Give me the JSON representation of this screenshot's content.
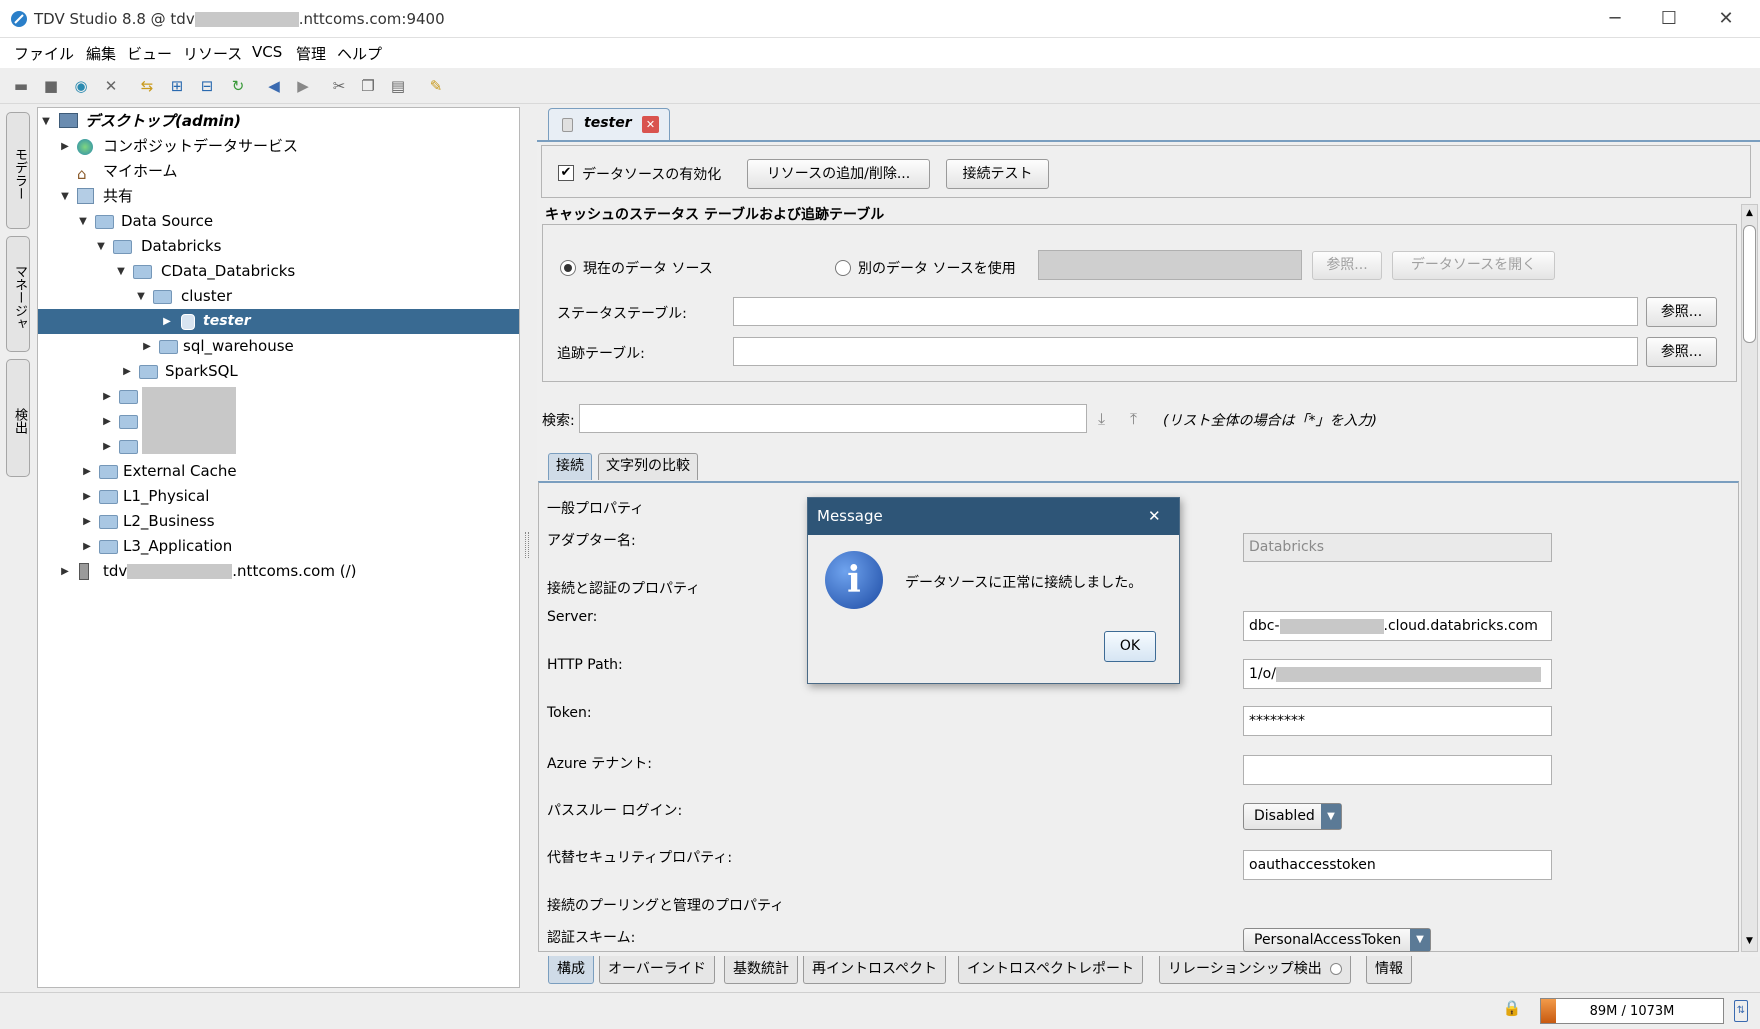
{
  "window": {
    "title": "TDV Studio 8.8 @ tdv",
    "title_suffix": ".nttcoms.com:9400",
    "minimize": "─",
    "maximize": "☐",
    "close": "✕"
  },
  "menu": [
    "ファイル",
    "編集",
    "ビュー",
    "リソース",
    "VCS",
    "管理",
    "ヘルプ"
  ],
  "side_tabs": [
    "モデラー",
    "マネージャ",
    "検出"
  ],
  "tree": {
    "root": "デスクトップ(admin)",
    "composite": "コンポジットデータサービス",
    "home": "マイホーム",
    "shared": "共有",
    "data_source": "Data Source",
    "databricks": "Databricks",
    "cdata": "CData_Databricks",
    "cluster": "cluster",
    "tester": "tester",
    "sql_warehouse": "sql_warehouse",
    "sparksql": "SparkSQL",
    "external_cache": "External Cache",
    "l1": "L1_Physical",
    "l2": "L2_Business",
    "l3": "L3_Application",
    "server_prefix": "tdv",
    "server_suffix": ".nttcoms.com (/)"
  },
  "editor_tab": "tester",
  "top_panel": {
    "enable_label": "データソースの有効化",
    "enable_checked": true,
    "add_remove": "リソースの追加/削除...",
    "test": "接続テスト"
  },
  "cache": {
    "heading": "キャッシュのステータス テーブルおよび追跡テーブル",
    "current": "現在のデータ ソース",
    "other": "別のデータ ソースを使用",
    "browse": "参照...",
    "open": "データソースを開く",
    "status_label": "ステータステーブル:",
    "status_value": "",
    "tracking_label": "追跡テーブル:",
    "tracking_value": ""
  },
  "search": {
    "label": "検索:",
    "value": "",
    "hint": "(リスト全体の場合は「*」を入力)"
  },
  "subtabs": [
    "接続",
    "文字列の比較"
  ],
  "props": {
    "general": "一般プロパティ",
    "adapter_label": "アダプター名:",
    "adapter_value": "Databricks",
    "conn_auth": "接続と認証のプロパティ",
    "server_label": "Server:",
    "server_prefix": "dbc-",
    "server_suffix": ".cloud.databricks.com",
    "http_label": "HTTP Path:",
    "http_prefix": "1/o/",
    "token_label": "Token:",
    "token_value": "********",
    "azure_label": "Azure テナント:",
    "azure_value": "",
    "passthru_label": "パススルー ログイン:",
    "passthru_value": "Disabled",
    "alt_sec_label": "代替セキュリティプロパティ:",
    "alt_sec_value": "oauthaccesstoken",
    "pooling": "接続のプーリングと管理のプロパティ",
    "auth_scheme_label": "認証スキーム:",
    "auth_scheme_value": "PersonalAccessToken"
  },
  "bottom_tabs": [
    "構成",
    "オーバーライド",
    "基数統計",
    "再イントロスペクト",
    "イントロスペクトレポート",
    "リレーションシップ検出",
    "情報"
  ],
  "dialog": {
    "title": "Message",
    "close": "✕",
    "icon": "i",
    "message": "データソースに正常に接続しました。",
    "ok": "OK"
  },
  "status": {
    "memory": "89M / 1073M",
    "memory_fraction": 0.083
  }
}
